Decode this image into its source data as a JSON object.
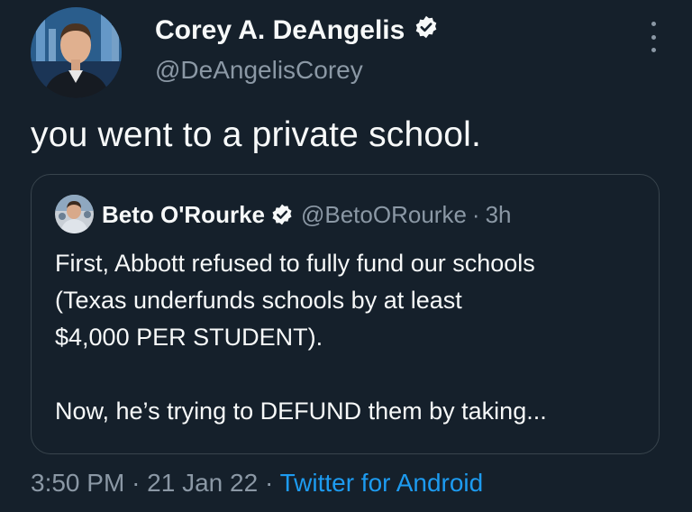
{
  "author": {
    "name": "Corey A. DeAngelis",
    "handle": "@DeAngelisCorey",
    "verified": true
  },
  "tweet": {
    "text": "you went to a private school."
  },
  "quoted_tweet": {
    "name": "Beto O'Rourke",
    "handle": "@BetoORourke",
    "separator": "·",
    "time": "3h",
    "verified": true,
    "lines": [
      "First, Abbott refused to fully fund our schools",
      "(Texas underfunds schools by at least",
      "$4,000 PER STUDENT).",
      "",
      "Now, he’s trying to DEFUND them by taking..."
    ]
  },
  "meta": {
    "time": "3:50 PM",
    "separator1": "·",
    "date": "21 Jan 22",
    "separator2": "·",
    "source": "Twitter for Android"
  },
  "colors": {
    "background": "#15202b",
    "text": "#f7f9f9",
    "secondary": "#8b98a5",
    "accent": "#1d9bf0",
    "border": "#38444d"
  },
  "icons": {
    "verified": "verified-badge-icon",
    "more": "more-options-icon"
  }
}
